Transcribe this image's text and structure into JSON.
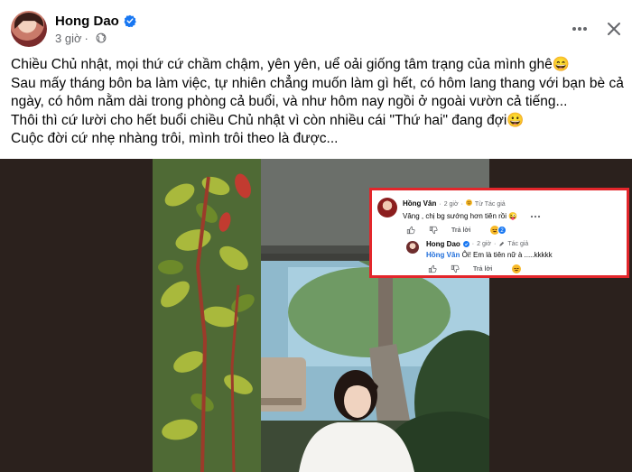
{
  "post": {
    "author": "Hong Dao",
    "time": "3 giờ",
    "lines": [
      "Chiều Chủ nhật, mọi thứ cứ chầm chậm, yên yên, uể oải giống tâm trạng của mình ghê😄",
      "Sau mấy tháng bôn ba làm việc, tự nhiên chẳng muốn làm gì hết, có hôm lang thang với bạn bè cả ngày, có hôm nằm dài trong phòng cả buổi, và như hôm nay ngồi ở ngoài vườn cả tiếng...",
      "Thôi thì cứ lười cho hết buổi chiều Chủ nhật vì còn nhiều cái \"Thứ hai\" đang đợi😀",
      "Cuộc đời cứ nhẹ nhàng trôi, mình trôi theo là được..."
    ]
  },
  "comments": {
    "first": {
      "author": "Hồng Vân",
      "time": "2 giờ",
      "badge": "Từ Tác giả",
      "text": "Vâng , chị bg sướng hơn tiên rồi 😜",
      "reply_label": "Trả lời"
    },
    "reply": {
      "author": "Hong Dao",
      "time": "2 giờ",
      "badge": "Tác giả",
      "mention": "Hồng Vân",
      "text": "Ôi! Em là tiên nữ à .....kkkkk",
      "reply_label": "Trả lời"
    }
  },
  "colors": {
    "link": "#216fdb",
    "verified": "#1877f2",
    "highlight_border": "#e3262b",
    "secondary_text": "#65676b"
  },
  "icons": [
    "verified-icon",
    "globe-icon",
    "more-icon",
    "close-icon",
    "like-icon",
    "dislike-icon",
    "reply-icon",
    "emoji-reaction-icon"
  ]
}
